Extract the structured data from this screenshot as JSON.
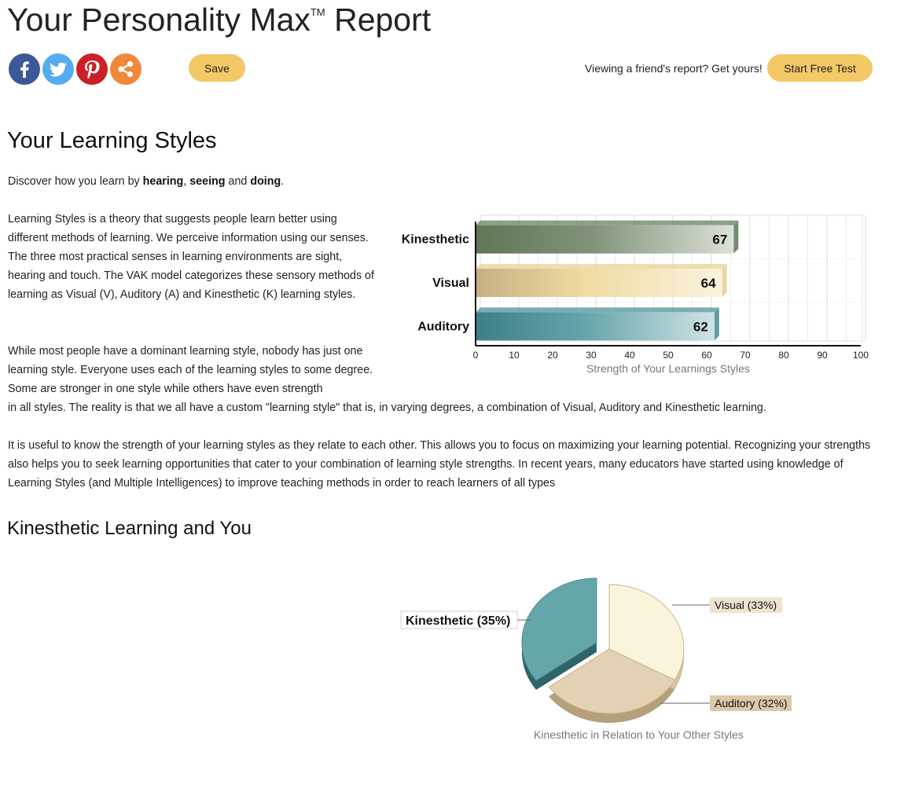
{
  "header": {
    "title": "Your Personality Max",
    "trademark": "TM",
    "title_end": "Report",
    "save_label": "Save",
    "promo_text": "Viewing a friend's report? Get yours!",
    "cta_label": "Start Free Test"
  },
  "social": {
    "facebook_color": "#3b5998",
    "twitter_color": "#55acee",
    "pinterest_color": "#cb2027",
    "share_color": "#f0883a",
    "icons": [
      "facebook-icon",
      "twitter-icon",
      "pinterest-icon",
      "share-icon"
    ]
  },
  "learning": {
    "heading": "Your Learning Styles",
    "intro_pre": "Discover how you learn by ",
    "intro_b1": "hearing",
    "intro_sep1": ", ",
    "intro_b2": "seeing",
    "intro_sep2": " and ",
    "intro_b3": "doing",
    "intro_end": ".",
    "p1": "Learning Styles is a theory that suggests people learn better using different methods of learning. We perceive information using our senses. The three most practical senses in learning environments are sight, hearing and touch. The VAK model categorizes these sensory methods of learning as Visual (V), Auditory (A) and Kinesthetic (K) learning styles.",
    "p2_wrapped": "While most people have a dominant learning style, nobody has just one learning style. Everyone uses each of the learning styles to some degree. Some are stronger in one style while others have even strength",
    "p2_full": "in all styles. The reality is that we all have a custom \"learning style\" that is, in varying degrees, a combination of Visual, Auditory and Kinesthetic learning.",
    "p3": "It is useful to know the strength of your learning styles as they relate to each other. This allows you to focus on maximizing your learning potential. Recognizing your strengths also helps you to seek learning opportunities that cater to your combination of learning style strengths. In recent years, many educators have started using knowledge of Learning Styles (and Multiple Intelligences) to improve teaching methods in order to reach learners of all types"
  },
  "kinesthetic": {
    "heading": "Kinesthetic Learning and You"
  },
  "chart_data": [
    {
      "type": "bar",
      "orientation": "horizontal",
      "categories": [
        "Kinesthetic",
        "Visual",
        "Auditory"
      ],
      "values": [
        67,
        64,
        62
      ],
      "xlim": [
        0,
        100
      ],
      "xticks": [
        0,
        10,
        20,
        30,
        40,
        50,
        60,
        70,
        80,
        90,
        100
      ],
      "xlabel": "Strength of Your Learnings Styles",
      "grid": true,
      "colors": [
        "#667f5f",
        "#e8d29a",
        "#4f9198"
      ]
    },
    {
      "type": "pie",
      "labels": [
        "Kinesthetic (35%)",
        "Visual (33%)",
        "Auditory (32%)"
      ],
      "values": [
        35,
        33,
        32
      ],
      "exploded": "Kinesthetic",
      "colors": [
        "#64a6aa",
        "#fbf4dc",
        "#e4d1b3"
      ],
      "caption": "Kinesthetic in Relation to Your Other Styles"
    }
  ]
}
